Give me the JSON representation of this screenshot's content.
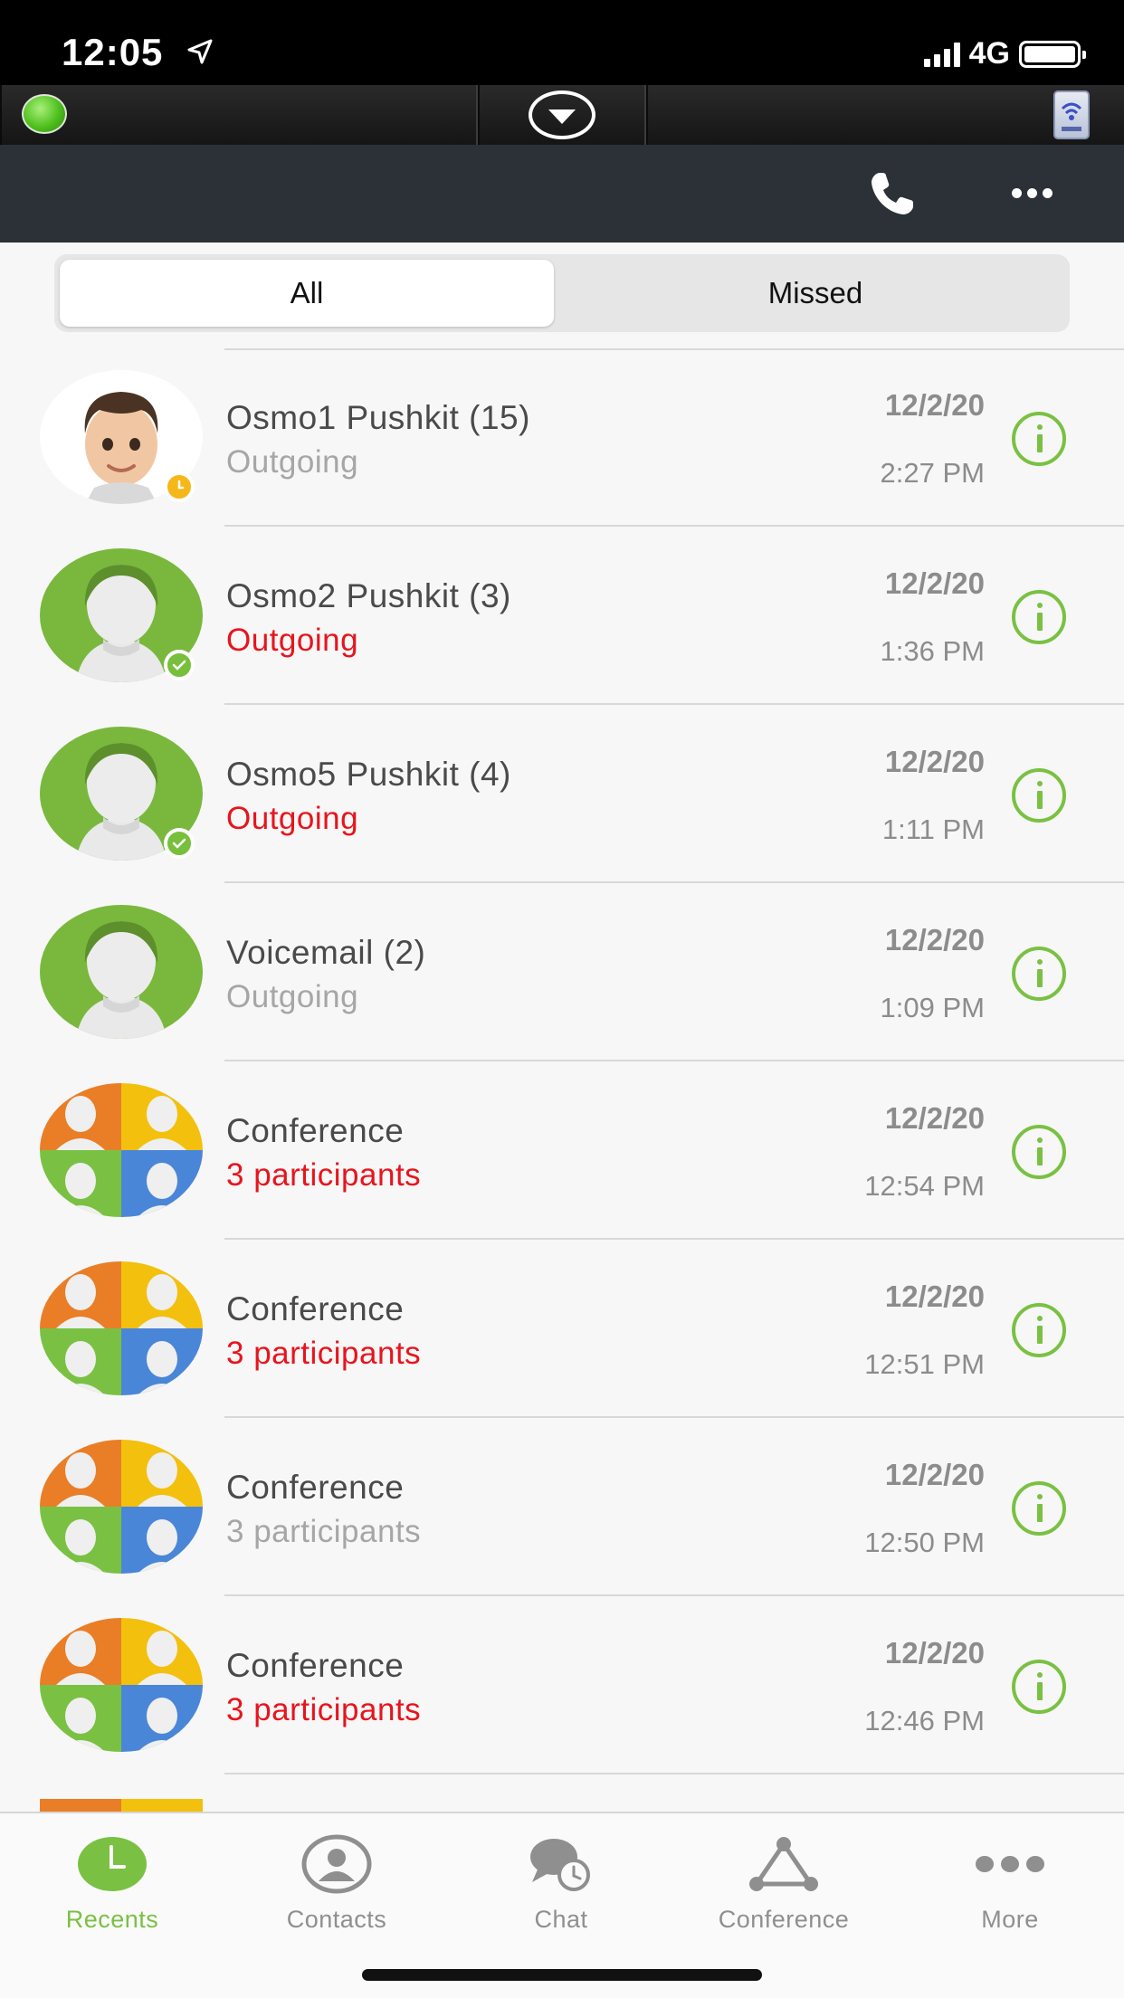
{
  "status_bar": {
    "time": "12:05",
    "network": "4G"
  },
  "header": {
    "call_icon": "phone-icon",
    "more_icon": "ellipsis-icon"
  },
  "segment": {
    "all_label": "All",
    "missed_label": "Missed",
    "selected": "All"
  },
  "calls": [
    {
      "name": "Osmo1 Pushkit (15)",
      "detail": "Outgoing",
      "detail_color": "gray",
      "date": "12/2/20",
      "time": "2:27 PM",
      "avatar": "memoji",
      "presence": "away"
    },
    {
      "name": "Osmo2 Pushkit (3)",
      "detail": "Outgoing",
      "detail_color": "red",
      "date": "12/2/20",
      "time": "1:36 PM",
      "avatar": "generic",
      "presence": "available"
    },
    {
      "name": "Osmo5 Pushkit (4)",
      "detail": "Outgoing",
      "detail_color": "red",
      "date": "12/2/20",
      "time": "1:11 PM",
      "avatar": "generic",
      "presence": "available"
    },
    {
      "name": "Voicemail (2)",
      "detail": "Outgoing",
      "detail_color": "gray",
      "date": "12/2/20",
      "time": "1:09 PM",
      "avatar": "generic",
      "presence": "none"
    },
    {
      "name": "Conference",
      "detail": "3 participants",
      "detail_color": "red",
      "date": "12/2/20",
      "time": "12:54 PM",
      "avatar": "conference",
      "presence": "none"
    },
    {
      "name": "Conference",
      "detail": "3 participants",
      "detail_color": "red",
      "date": "12/2/20",
      "time": "12:51 PM",
      "avatar": "conference",
      "presence": "none"
    },
    {
      "name": "Conference",
      "detail": "3 participants",
      "detail_color": "gray",
      "date": "12/2/20",
      "time": "12:50 PM",
      "avatar": "conference",
      "presence": "none"
    },
    {
      "name": "Conference",
      "detail": "3 participants",
      "detail_color": "red",
      "date": "12/2/20",
      "time": "12:46 PM",
      "avatar": "conference",
      "presence": "none"
    }
  ],
  "tabs": [
    {
      "label": "Recents",
      "icon": "clock-icon",
      "active": true
    },
    {
      "label": "Contacts",
      "icon": "person-icon",
      "active": false
    },
    {
      "label": "Chat",
      "icon": "chat-icon",
      "active": false
    },
    {
      "label": "Conference",
      "icon": "conference-icon",
      "active": false
    },
    {
      "label": "More",
      "icon": "more-dots-icon",
      "active": false
    }
  ],
  "colors": {
    "accent": "#7ac143",
    "missed_red": "#e8141d",
    "nav_bg": "#2c3137"
  }
}
